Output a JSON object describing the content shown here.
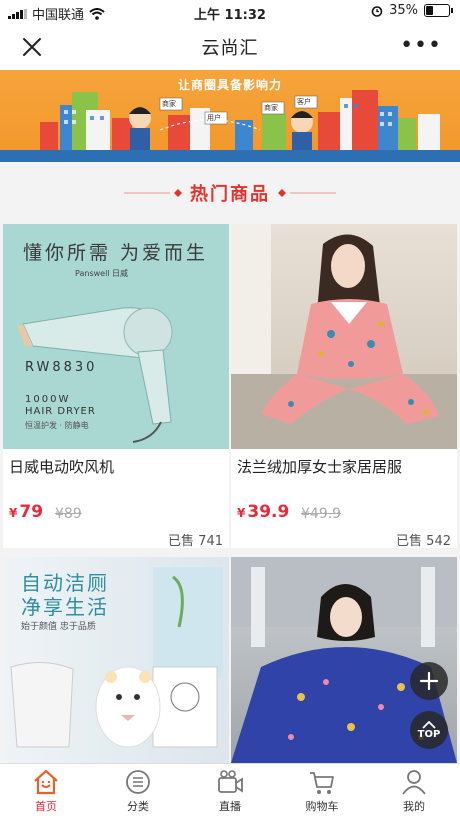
{
  "status_bar": {
    "carrier": "中国联通",
    "time": "上午 11:32",
    "battery": "35%",
    "battery_level": 0.35
  },
  "navbar": {
    "title": "云尚汇"
  },
  "banner": {
    "slogan": "让商圈具备影响力",
    "signs": [
      "商家",
      "用户",
      "商家",
      "客户"
    ]
  },
  "section": {
    "title": "热门商品"
  },
  "products": [
    {
      "name": "日威电动吹风机",
      "currency": "¥",
      "price": "79",
      "original_price": "¥89",
      "sold": "已售 741",
      "image_texts": {
        "headline": "懂你所需 为爱而生",
        "brand": "Panswell 日威",
        "model": "RW8830",
        "watts": "1000W",
        "type": "HAIR DRYER",
        "foot": "恒温护发 · 防静电"
      }
    },
    {
      "name": "法兰绒加厚女士家居居服",
      "currency": "¥",
      "price": "39.9",
      "original_price": "¥49.9",
      "sold": "已售 542"
    },
    {
      "name": "",
      "image_texts": {
        "headline1": "自动洁厕",
        "headline2": "净享生活",
        "sub": "始于颜值 忠于品质"
      }
    },
    {
      "name": ""
    }
  ],
  "floating": {
    "top_label": "TOP"
  },
  "tabbar": {
    "items": [
      {
        "label": "首页",
        "icon": "home-icon",
        "active": true
      },
      {
        "label": "分类",
        "icon": "category-icon",
        "active": false
      },
      {
        "label": "直播",
        "icon": "camera-icon",
        "active": false
      },
      {
        "label": "购物车",
        "icon": "cart-icon",
        "active": false
      },
      {
        "label": "我的",
        "icon": "user-icon",
        "active": false
      }
    ]
  },
  "colors": {
    "accent": "#e8293c",
    "banner": "#f39b30",
    "banner_ground": "#2d6fb3"
  }
}
